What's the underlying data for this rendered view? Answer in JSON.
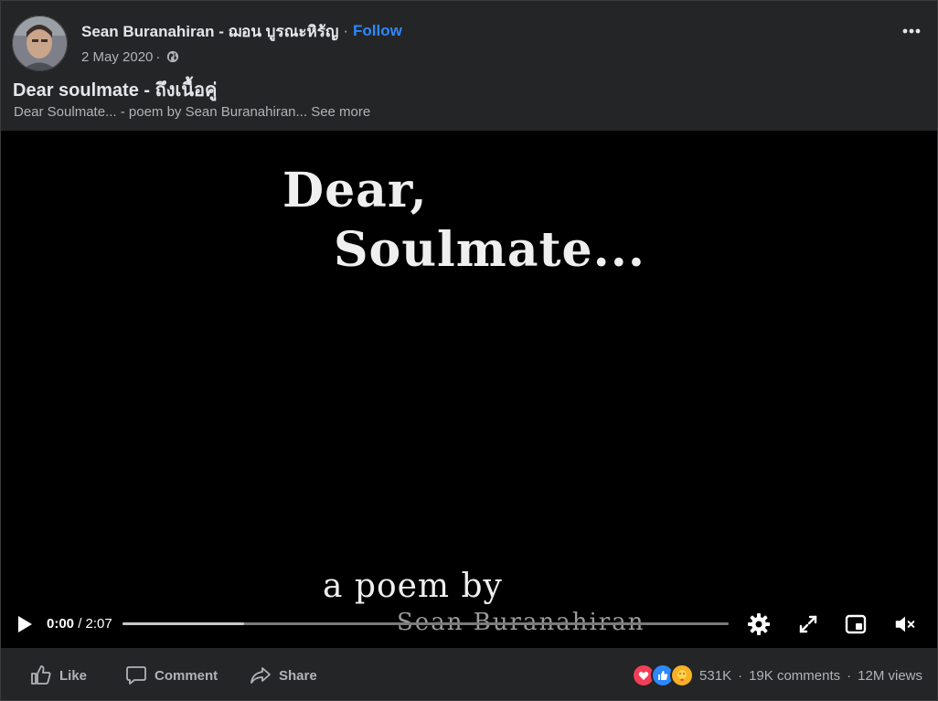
{
  "post": {
    "author": "Sean Buranahiran - ฌอน บูรณะหิรัญ",
    "separator": "·",
    "follow_label": "Follow",
    "date": "2 May 2020",
    "date_separator": "·",
    "privacy_icon": "globe-icon",
    "more_icon": "more-options-icon",
    "title": "Dear soulmate - ถึงเนื้อคู่",
    "description": "Dear Soulmate... - poem by Sean Buranahiran...",
    "see_more_label": "See more"
  },
  "video": {
    "frame_text": {
      "line1": "Dear,",
      "line2": "Soulmate...",
      "line3": "a poem by",
      "line4": "Sean Buranahiran"
    },
    "current_time": "0:00",
    "time_separator": " / ",
    "duration": "2:07",
    "buffered_fraction": 0.2,
    "controls": [
      "play-icon",
      "settings-icon",
      "fullscreen-icon",
      "picture-in-picture-icon",
      "volume-muted-icon"
    ]
  },
  "actions": {
    "like_label": "Like",
    "comment_label": "Comment",
    "share_label": "Share"
  },
  "stats": {
    "reactions": [
      "love-reaction-icon",
      "like-reaction-icon",
      "care-reaction-icon"
    ],
    "reaction_count": "531K",
    "separator": "·",
    "comments": "19K comments",
    "views": "12M views"
  },
  "colors": {
    "background": "#242526",
    "text_primary": "#e4e6eb",
    "text_secondary": "#b0b3b8",
    "accent": "#2d88ff",
    "video_bg": "#000000"
  }
}
